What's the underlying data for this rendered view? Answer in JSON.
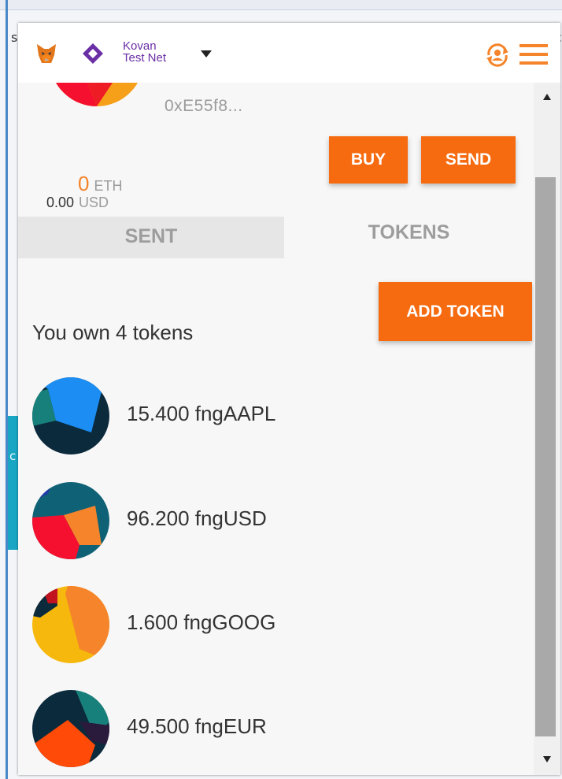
{
  "colors": {
    "accent": "#f66a10",
    "network": "#6a2ea5",
    "eth_amount": "#f5842a",
    "muted_text": "#9b9b9b",
    "tab_inactive_bg": "#e6e6e6",
    "scrollbar_thumb": "#a9a9a9"
  },
  "header": {
    "network_line1": "Kovan",
    "network_line2": "Test Net",
    "icons": [
      "metamask-fox-icon",
      "network-diamond-icon",
      "caret-down-icon",
      "account-switch-icon",
      "hamburger-menu-icon"
    ]
  },
  "account": {
    "address": "0xE55f8..."
  },
  "balance": {
    "eth_amount": "0",
    "eth_unit": "ETH",
    "usd_amount": "0.00",
    "usd_unit": "USD"
  },
  "actions": {
    "buy_label": "BUY",
    "send_label": "SEND"
  },
  "tabs": [
    {
      "label": "SENT",
      "selected": false
    },
    {
      "label": "TOKENS",
      "selected": true
    }
  ],
  "tokens_section": {
    "owned_label": "You own 4 tokens",
    "add_token_label": "ADD TOKEN",
    "tokens": [
      {
        "amount_label": "15.400 fngAAPL"
      },
      {
        "amount_label": "96.200 fngUSD"
      },
      {
        "amount_label": "1.600 fngGOOG"
      },
      {
        "amount_label": "49.500 fngEUR"
      }
    ]
  }
}
